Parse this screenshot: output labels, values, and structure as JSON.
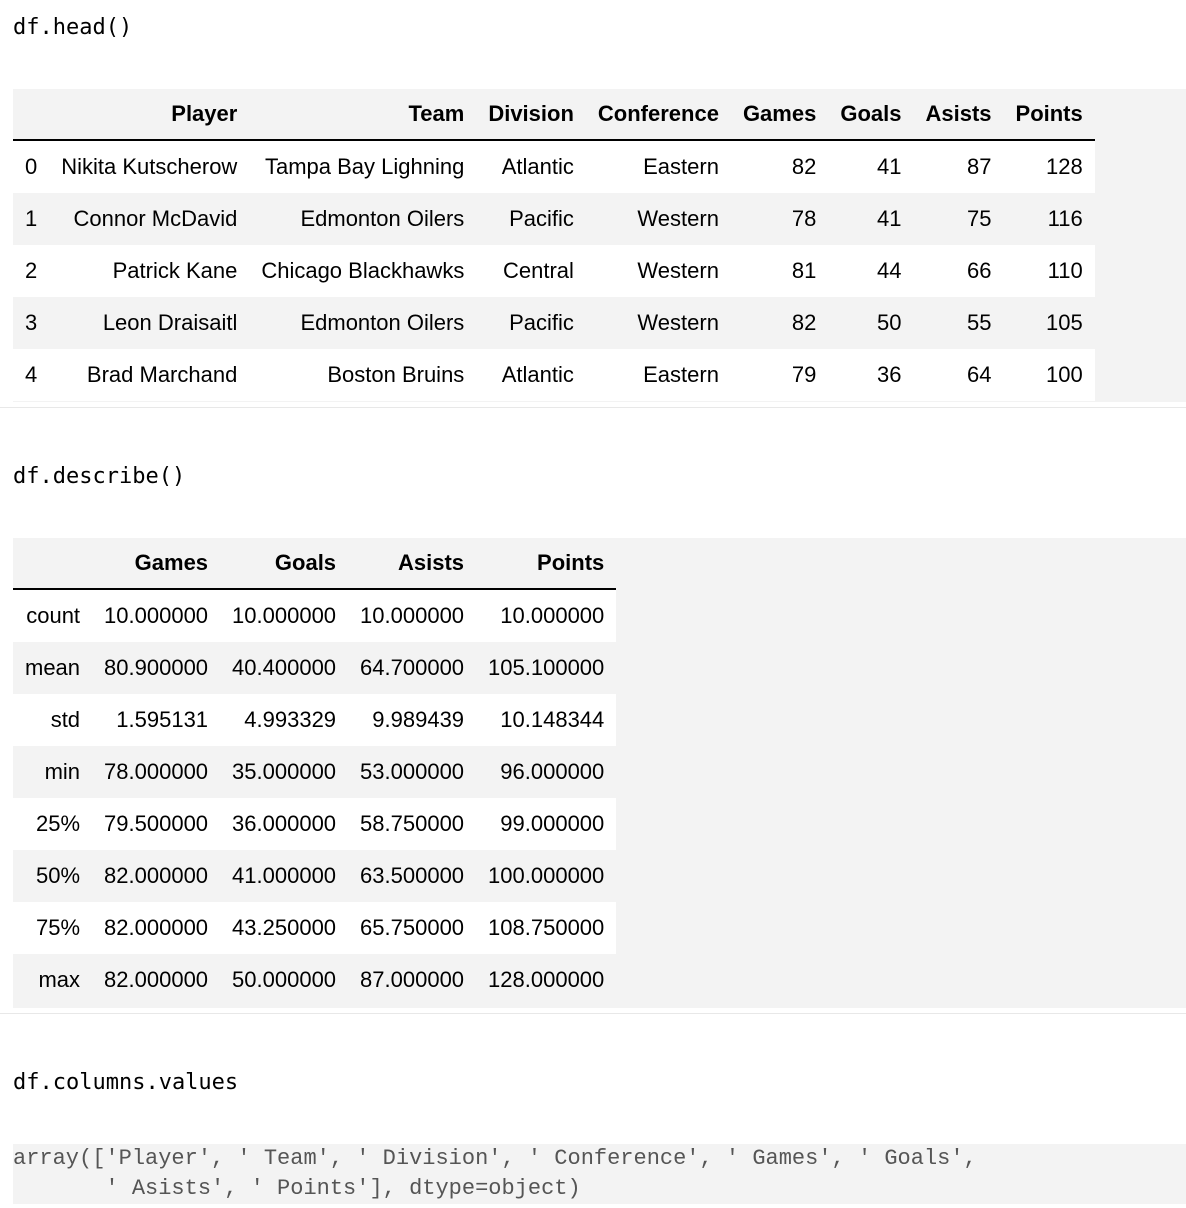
{
  "cells": {
    "head_code": "df.head()",
    "describe_code": "df.describe()",
    "columns_code": "df.columns.values"
  },
  "head_table": {
    "columns": [
      "",
      "Player",
      "Team",
      "Division",
      "Conference",
      "Games",
      "Goals",
      "Asists",
      "Points"
    ],
    "rows": [
      [
        "0",
        "Nikita Kutscherow",
        "Tampa Bay Lighning",
        "Atlantic",
        "Eastern",
        "82",
        "41",
        "87",
        "128"
      ],
      [
        "1",
        "Connor McDavid",
        "Edmonton Oilers",
        "Pacific",
        "Western",
        "78",
        "41",
        "75",
        "116"
      ],
      [
        "2",
        "Patrick Kane",
        "Chicago Blackhawks",
        "Central",
        "Western",
        "81",
        "44",
        "66",
        "110"
      ],
      [
        "3",
        "Leon Draisaitl",
        "Edmonton Oilers",
        "Pacific",
        "Western",
        "82",
        "50",
        "55",
        "105"
      ],
      [
        "4",
        "Brad Marchand",
        "Boston Bruins",
        "Atlantic",
        "Eastern",
        "79",
        "36",
        "64",
        "100"
      ]
    ]
  },
  "describe_table": {
    "columns": [
      "",
      "Games",
      "Goals",
      "Asists",
      "Points"
    ],
    "rows": [
      [
        "count",
        "10.000000",
        "10.000000",
        "10.000000",
        "10.000000"
      ],
      [
        "mean",
        "80.900000",
        "40.400000",
        "64.700000",
        "105.100000"
      ],
      [
        "std",
        "1.595131",
        "4.993329",
        "9.989439",
        "10.148344"
      ],
      [
        "min",
        "78.000000",
        "35.000000",
        "53.000000",
        "96.000000"
      ],
      [
        "25%",
        "79.500000",
        "36.000000",
        "58.750000",
        "99.000000"
      ],
      [
        "50%",
        "82.000000",
        "41.000000",
        "63.500000",
        "100.000000"
      ],
      [
        "75%",
        "82.000000",
        "43.250000",
        "65.750000",
        "108.750000"
      ],
      [
        "max",
        "82.000000",
        "50.000000",
        "87.000000",
        "128.000000"
      ]
    ]
  },
  "columns_output": {
    "line1": "array(['Player', ' Team', ' Division', ' Conference', ' Games', ' Goals',",
    "line2": "       ' Asists', ' Points'], dtype=object)"
  }
}
